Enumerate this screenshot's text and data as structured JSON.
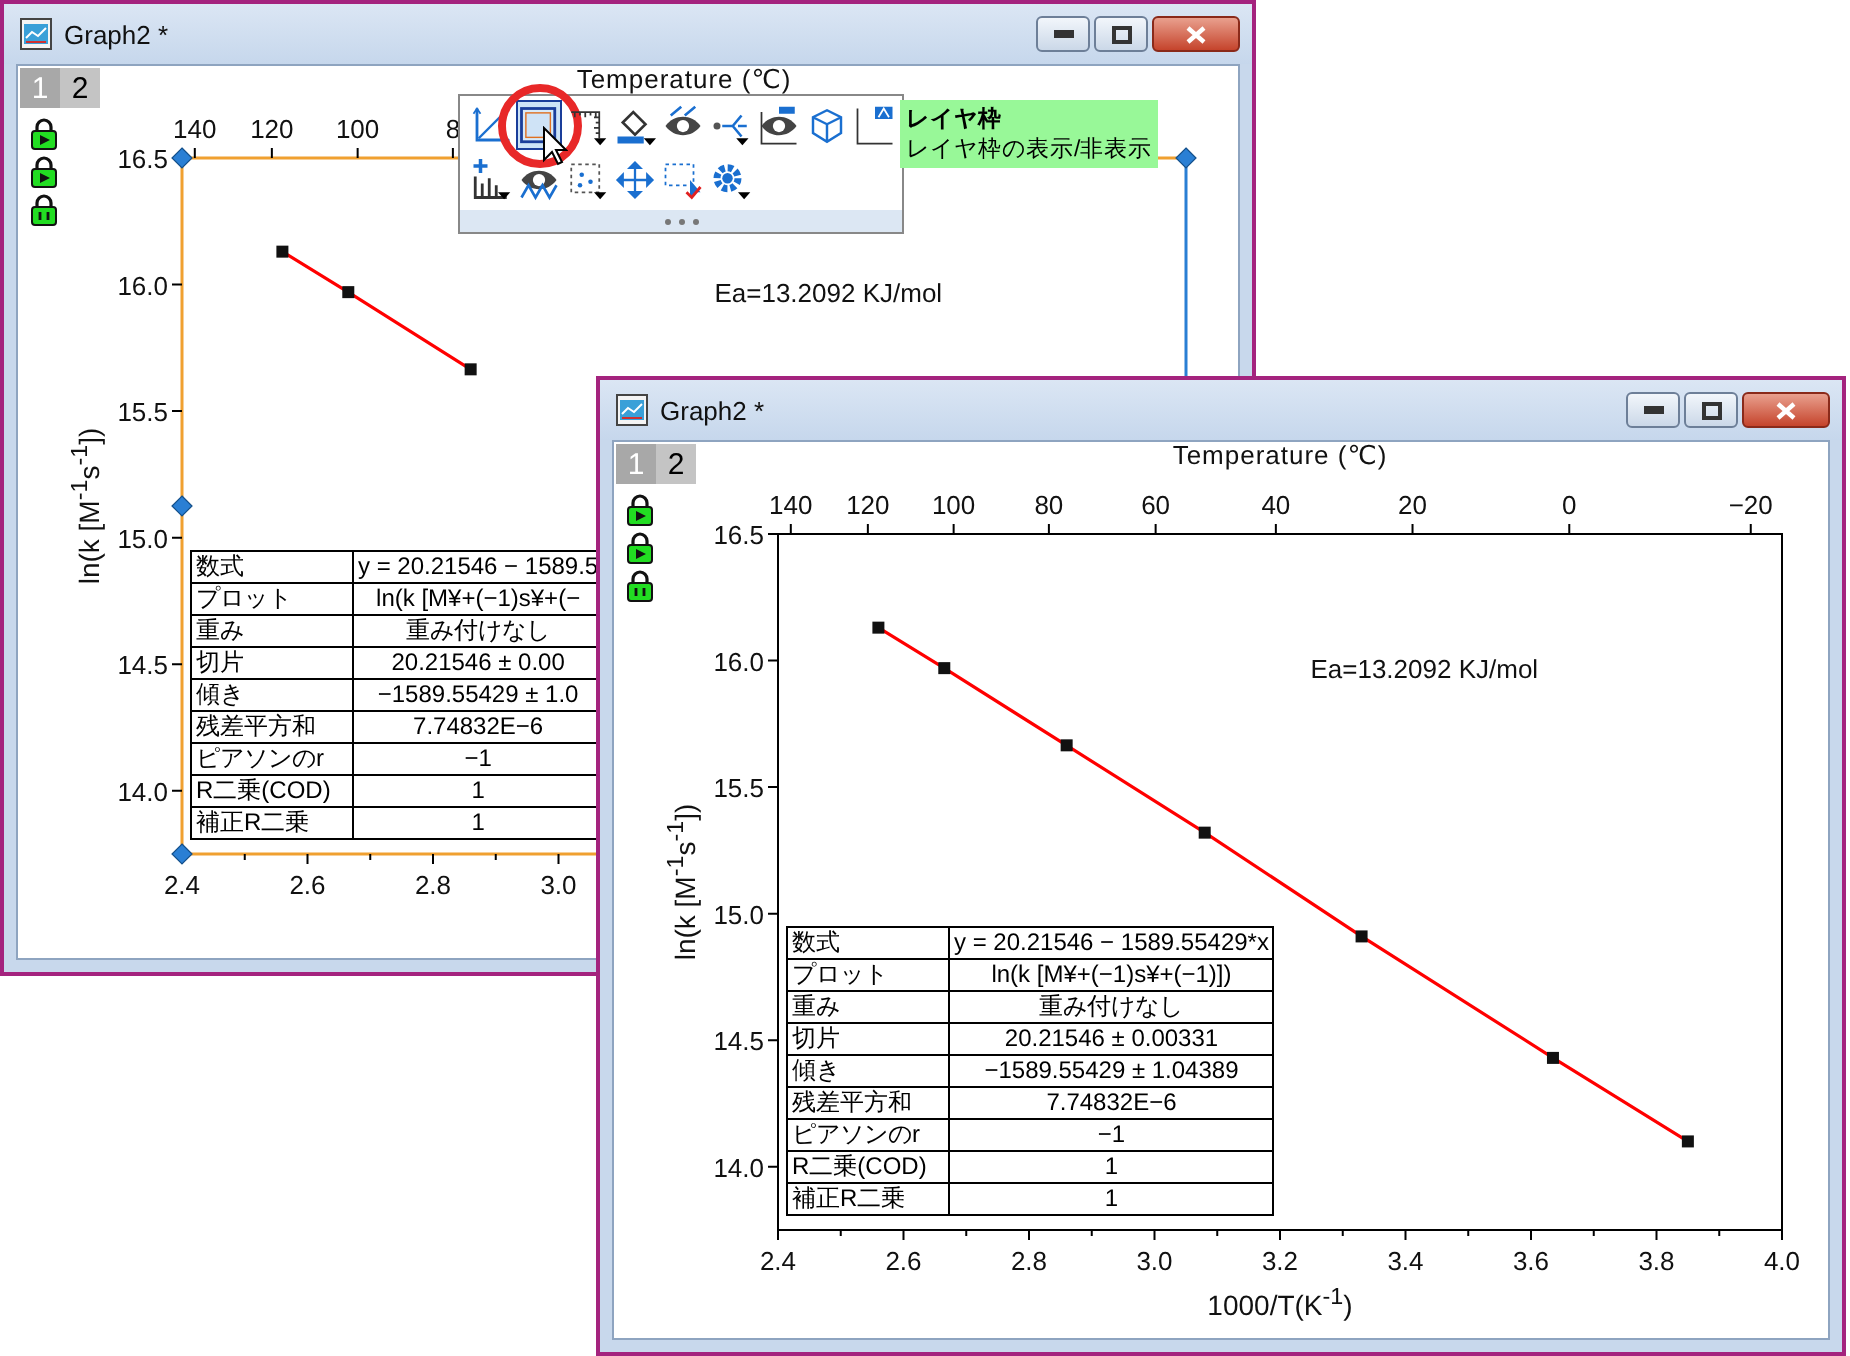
{
  "windows": [
    {
      "title": "Graph2 *",
      "layer_tabs": [
        {
          "label": "1",
          "selected": true
        },
        {
          "label": "2",
          "selected": false
        }
      ],
      "graph": {
        "layer_selected": true,
        "chart_data": {
          "type": "line",
          "x": [
            2.56,
            2.665,
            2.86
          ],
          "series": [
            {
              "color": "#ff0000",
              "marker": "square",
              "values": [
                16.13,
                15.97,
                15.665
              ]
            }
          ],
          "ylabel": "ln(k [M$^{-1}$s$^{-1}$])",
          "xlim": [
            2.4,
            4.0
          ],
          "ylim": [
            13.75,
            16.5
          ],
          "xticks": [
            {
              "value": 2.4,
              "label": "2.4"
            },
            {
              "value": 2.6,
              "label": "2.6"
            },
            {
              "value": 2.8,
              "label": "2.8"
            },
            {
              "value": 3.0,
              "label": "3.0"
            }
          ],
          "yticks": [
            {
              "value": 14.0,
              "label": "14.0"
            },
            {
              "value": 14.5,
              "label": "14.5"
            },
            {
              "value": 15.0,
              "label": "15.0"
            },
            {
              "value": 15.5,
              "label": "15.5"
            },
            {
              "value": 16.0,
              "label": "16.0"
            },
            {
              "value": 16.5,
              "label": "16.5"
            }
          ],
          "annotations": [
            "Ea=13.2092 KJ/mol"
          ]
        },
        "top_axis": {
          "title": "Temperature (℃)",
          "labels": [
            "140",
            "120",
            "100",
            "8"
          ]
        },
        "stats_table": [
          {
            "name": "数式",
            "value": "y = 20.21546 − 1589.5"
          },
          {
            "name": "プロット",
            "value": "ln(k [M¥+(−1)s¥+(−"
          },
          {
            "name": "重み",
            "value": "重み付けなし"
          },
          {
            "name": "切片",
            "value": "20.21546 ± 0.00"
          },
          {
            "name": "傾き",
            "value": "−1589.55429 ± 1.0"
          },
          {
            "name": "残差平方和",
            "value": "7.74832E−6"
          },
          {
            "name": "ピアソンのr",
            "value": "−1"
          },
          {
            "name": "R二乗(COD)",
            "value": "1"
          },
          {
            "name": "補正R二乗",
            "value": "1"
          }
        ]
      }
    },
    {
      "title": "Graph2 *",
      "layer_tabs": [
        {
          "label": "1",
          "selected": true
        },
        {
          "label": "2",
          "selected": false
        }
      ],
      "graph": {
        "layer_selected": false,
        "chart_data": {
          "type": "line",
          "x": [
            2.56,
            2.665,
            2.86,
            3.08,
            3.33,
            3.635,
            3.85
          ],
          "series": [
            {
              "color": "#ff0000",
              "marker": "square",
              "values": [
                16.13,
                15.97,
                15.665,
                15.32,
                14.91,
                14.43,
                14.1
              ]
            }
          ],
          "xlabel": "1000/T(K$^{-1}$)",
          "ylabel": "ln(k [M$^{-1}$s$^{-1}$])",
          "xlim": [
            2.4,
            4.0
          ],
          "ylim": [
            13.75,
            16.5
          ],
          "xticks": [
            {
              "value": 2.4,
              "label": "2.4"
            },
            {
              "value": 2.6,
              "label": "2.6"
            },
            {
              "value": 2.8,
              "label": "2.8"
            },
            {
              "value": 3.0,
              "label": "3.0"
            },
            {
              "value": 3.2,
              "label": "3.2"
            },
            {
              "value": 3.4,
              "label": "3.4"
            },
            {
              "value": 3.6,
              "label": "3.6"
            },
            {
              "value": 3.8,
              "label": "3.8"
            },
            {
              "value": 4.0,
              "label": "4.0"
            }
          ],
          "yticks": [
            {
              "value": 14.0,
              "label": "14.0"
            },
            {
              "value": 14.5,
              "label": "14.5"
            },
            {
              "value": 15.0,
              "label": "15.0"
            },
            {
              "value": 15.5,
              "label": "15.5"
            },
            {
              "value": 16.0,
              "label": "16.0"
            },
            {
              "value": 16.5,
              "label": "16.5"
            }
          ],
          "annotations": [
            "Ea=13.2092 KJ/mol"
          ]
        },
        "top_axis": {
          "title": "Temperature (℃)",
          "labels": [
            "140",
            "120",
            "100",
            "80",
            "60",
            "40",
            "20",
            "0",
            "−20"
          ]
        },
        "stats_table": [
          {
            "name": "数式",
            "value": "y = 20.21546 − 1589.55429*x"
          },
          {
            "name": "プロット",
            "value": "ln(k [M¥+(−1)s¥+(−1)])"
          },
          {
            "name": "重み",
            "value": "重み付けなし"
          },
          {
            "name": "切片",
            "value": "20.21546 ± 0.00331"
          },
          {
            "name": "傾き",
            "value": "−1589.55429 ± 1.04389"
          },
          {
            "name": "残差平方和",
            "value": "7.74832E−6"
          },
          {
            "name": "ピアソンのr",
            "value": "−1"
          },
          {
            "name": "R二乗(COD)",
            "value": "1"
          },
          {
            "name": "補正R二乗",
            "value": "1"
          }
        ]
      }
    }
  ],
  "mini_toolbar": {
    "rows": [
      [
        {
          "kind": "axes",
          "selected": false
        },
        {
          "kind": "frame",
          "selected": true
        },
        {
          "kind": "ticks",
          "selected": false
        },
        {
          "kind": "fill",
          "selected": false
        },
        {
          "kind": "hide",
          "selected": false
        },
        {
          "kind": "share",
          "selected": false
        },
        {
          "kind": "eye-frame",
          "selected": false
        },
        {
          "kind": "cube",
          "selected": false
        },
        {
          "kind": "text-frame",
          "selected": false
        }
      ],
      [
        {
          "kind": "add-plot",
          "selected": false
        },
        {
          "kind": "eye-wave",
          "selected": false
        },
        {
          "kind": "scatter",
          "selected": false
        },
        {
          "kind": "move",
          "selected": false
        },
        {
          "kind": "select",
          "selected": false
        },
        {
          "kind": "gear",
          "selected": false
        }
      ]
    ]
  },
  "tooltip": {
    "title": "レイヤ枠",
    "text": "レイヤ枠の表示/非表示"
  }
}
